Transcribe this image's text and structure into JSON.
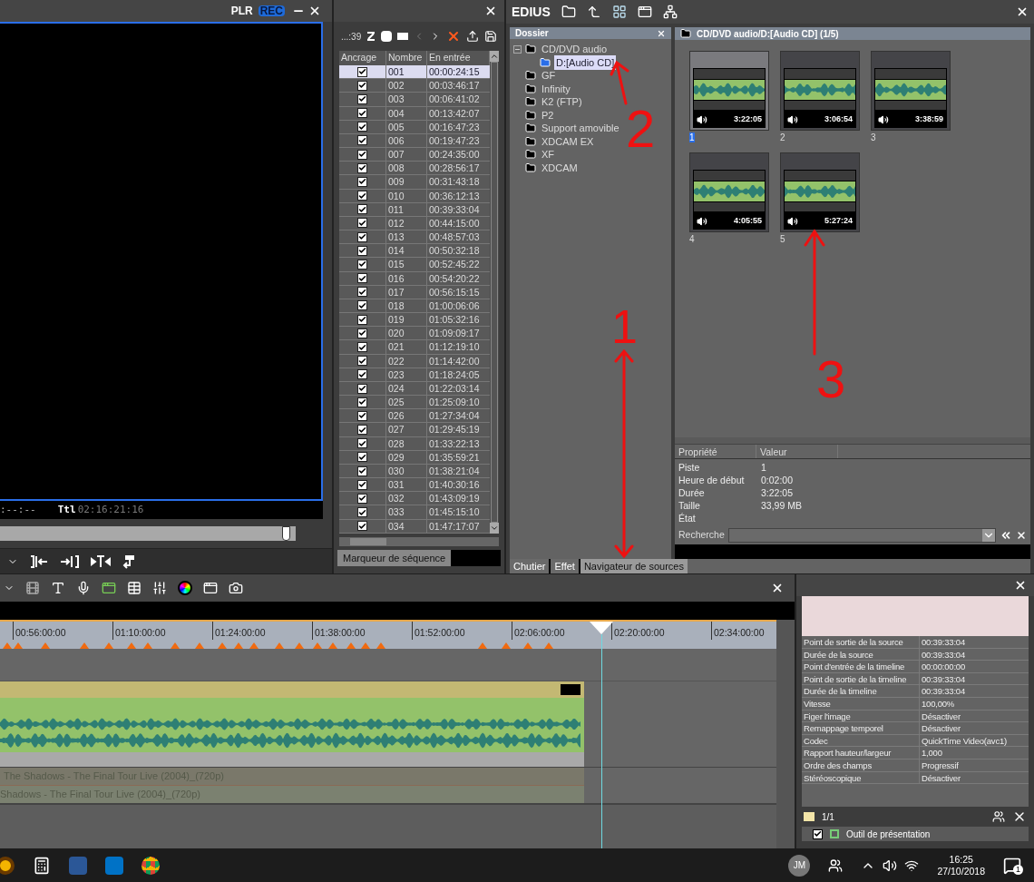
{
  "player": {
    "modes": [
      {
        "label": "PLR",
        "selected": false
      },
      {
        "label": "REC",
        "selected": true
      }
    ],
    "timecode": ":--:--",
    "total_label": "Ttl",
    "total": "02:16:21:16",
    "scrub": {
      "level": 0.97
    }
  },
  "markers": {
    "counter": "...:39",
    "columns": [
      "Ancrage",
      "Nombre",
      "En entrée"
    ],
    "rows": [
      {
        "anchored": true,
        "number": "001",
        "in": "00:00:24:15",
        "selected": true
      },
      {
        "anchored": true,
        "number": "002",
        "in": "00:03:46:17",
        "selected": false
      },
      {
        "anchored": true,
        "number": "003",
        "in": "00:06:41:02",
        "selected": false
      },
      {
        "anchored": true,
        "number": "004",
        "in": "00:13:42:07",
        "selected": false
      },
      {
        "anchored": true,
        "number": "005",
        "in": "00:16:47:23",
        "selected": false
      },
      {
        "anchored": true,
        "number": "006",
        "in": "00:19:47:23",
        "selected": false
      },
      {
        "anchored": true,
        "number": "007",
        "in": "00:24:35:00",
        "selected": false
      },
      {
        "anchored": true,
        "number": "008",
        "in": "00:28:56:17",
        "selected": false
      },
      {
        "anchored": true,
        "number": "009",
        "in": "00:31:43:18",
        "selected": false
      },
      {
        "anchored": true,
        "number": "010",
        "in": "00:36:12:13",
        "selected": false
      },
      {
        "anchored": true,
        "number": "011",
        "in": "00:39:33:04",
        "selected": false
      },
      {
        "anchored": true,
        "number": "012",
        "in": "00:44:15:00",
        "selected": false
      },
      {
        "anchored": true,
        "number": "013",
        "in": "00:48:57:03",
        "selected": false
      },
      {
        "anchored": true,
        "number": "014",
        "in": "00:50:32:18",
        "selected": false
      },
      {
        "anchored": true,
        "number": "015",
        "in": "00:52:45:22",
        "selected": false
      },
      {
        "anchored": true,
        "number": "016",
        "in": "00:54:20:22",
        "selected": false
      },
      {
        "anchored": true,
        "number": "017",
        "in": "00:56:15:15",
        "selected": false
      },
      {
        "anchored": true,
        "number": "018",
        "in": "01:00:06:06",
        "selected": false
      },
      {
        "anchored": true,
        "number": "019",
        "in": "01:05:32:16",
        "selected": false
      },
      {
        "anchored": true,
        "number": "020",
        "in": "01:09:09:17",
        "selected": false
      },
      {
        "anchored": true,
        "number": "021",
        "in": "01:12:19:10",
        "selected": false
      },
      {
        "anchored": true,
        "number": "022",
        "in": "01:14:42:00",
        "selected": false
      },
      {
        "anchored": true,
        "number": "023",
        "in": "01:18:24:05",
        "selected": false
      },
      {
        "anchored": true,
        "number": "024",
        "in": "01:22:03:14",
        "selected": false
      },
      {
        "anchored": true,
        "number": "025",
        "in": "01:25:09:10",
        "selected": false
      },
      {
        "anchored": true,
        "number": "026",
        "in": "01:27:34:04",
        "selected": false
      },
      {
        "anchored": true,
        "number": "027",
        "in": "01:29:45:19",
        "selected": false
      },
      {
        "anchored": true,
        "number": "028",
        "in": "01:33:22:13",
        "selected": false
      },
      {
        "anchored": true,
        "number": "029",
        "in": "01:35:59:21",
        "selected": false
      },
      {
        "anchored": true,
        "number": "030",
        "in": "01:38:21:04",
        "selected": false
      },
      {
        "anchored": true,
        "number": "031",
        "in": "01:40:30:16",
        "selected": false
      },
      {
        "anchored": true,
        "number": "032",
        "in": "01:43:09:19",
        "selected": false
      },
      {
        "anchored": true,
        "number": "033",
        "in": "01:45:15:10",
        "selected": false
      },
      {
        "anchored": true,
        "number": "034",
        "in": "01:47:17:07",
        "selected": false
      }
    ],
    "tab": "Marqueur de séquence"
  },
  "bin": {
    "app_title": "EDIUS",
    "folder_header": "Dossier",
    "tree": [
      {
        "label": "CD/DVD audio",
        "selected": false,
        "expanded": true,
        "children": [
          {
            "label": "D:[Audio CD]",
            "selected": true
          }
        ]
      },
      {
        "label": "GF",
        "selected": false
      },
      {
        "label": "Infinity",
        "selected": false
      },
      {
        "label": "K2 (FTP)",
        "selected": false
      },
      {
        "label": "P2",
        "selected": false
      },
      {
        "label": "Support amovible",
        "selected": false
      },
      {
        "label": "XDCAM EX",
        "selected": false
      },
      {
        "label": "XF",
        "selected": false
      },
      {
        "label": "XDCAM",
        "selected": false
      }
    ],
    "path": "CD/DVD audio/D:[Audio CD] (1/5)",
    "clips": [
      {
        "name": "1",
        "duration": "3:22:05",
        "selected": true
      },
      {
        "name": "2",
        "duration": "3:06:54",
        "selected": false
      },
      {
        "name": "3",
        "duration": "3:38:59",
        "selected": false
      },
      {
        "name": "4",
        "duration": "4:05:55",
        "selected": false
      },
      {
        "name": "5",
        "duration": "5:27:24",
        "selected": false
      }
    ],
    "properties": {
      "columns": [
        "Propriété",
        "Valeur"
      ],
      "rows": [
        {
          "name": "Piste",
          "value": "1"
        },
        {
          "name": "Heure de début",
          "value": "0:02:00"
        },
        {
          "name": "Durée",
          "value": "3:22:05"
        },
        {
          "name": "Taille",
          "value": "33,99 MB"
        },
        {
          "name": "État"
        }
      ]
    },
    "search_label": "Recherche",
    "tabs": [
      {
        "label": "Chutier",
        "selected": false
      },
      {
        "label": "Effet",
        "selected": false
      },
      {
        "label": "Navigateur de sources",
        "selected": true
      }
    ]
  },
  "timeline": {
    "ruler": [
      "00:56:00:00",
      "01:10:00:00",
      "01:24:00:00",
      "01:38:00:00",
      "01:52:00:00",
      "02:06:00:00",
      "02:20:00:00",
      "02:34:00:00"
    ],
    "muted_clips": [
      "The Shadows - The Final Tour Live (2004)_(720p)",
      "Shadows - The Final Tour Live (2004)_(720p)"
    ]
  },
  "clip_info": {
    "rows": [
      {
        "name": "Point de sortie de la source",
        "value": "00:39:33:04"
      },
      {
        "name": "Durée de la source",
        "value": "00:39:33:04"
      },
      {
        "name": "Point d'entrée de la timeline",
        "value": "00:00:00:00"
      },
      {
        "name": "Point de sortie de la timeline",
        "value": "00:39:33:04"
      },
      {
        "name": "Durée de la timeline",
        "value": "00:39:33:04"
      },
      {
        "name": "Vitesse",
        "value": "100,00%"
      },
      {
        "name": "Figer l'image",
        "value": "Désactiver"
      },
      {
        "name": "Remappage temporel",
        "value": "Désactiver"
      },
      {
        "name": "Codec",
        "value": "QuickTime Video(avc1)"
      },
      {
        "name": "Rapport hauteur/largeur",
        "value": "1,000"
      },
      {
        "name": "Ordre des champs",
        "value": "Progressif"
      },
      {
        "name": "Stéréoscopique",
        "value": "Désactiver"
      }
    ],
    "page": "1/1",
    "layout_tool": {
      "label": "Outil de présentation",
      "checked": true
    }
  },
  "taskbar": {
    "user": "JM",
    "time": "16:25",
    "date": "27/10/2018",
    "notifications": "1"
  },
  "annotations": [
    "2",
    "1",
    "3"
  ]
}
